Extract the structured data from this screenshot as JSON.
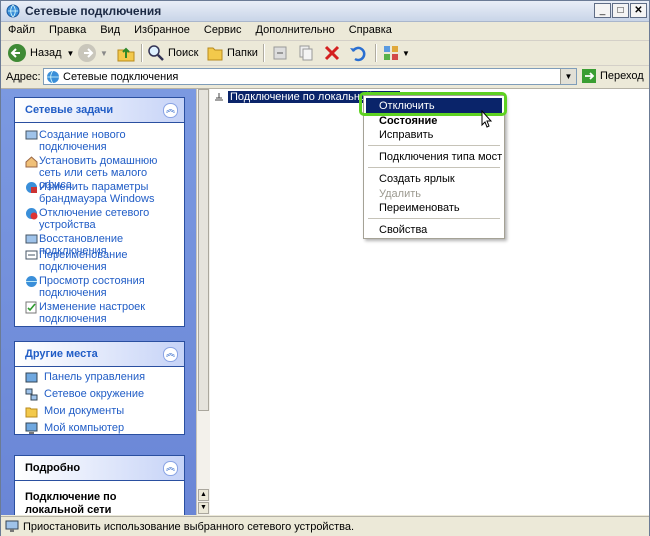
{
  "window": {
    "title": "Сетевые подключения"
  },
  "menu": [
    "Файл",
    "Правка",
    "Вид",
    "Избранное",
    "Сервис",
    "Дополнительно",
    "Справка"
  ],
  "toolbar": {
    "back": "Назад",
    "search": "Поиск",
    "folders": "Папки"
  },
  "address": {
    "label": "Адрес:",
    "value": "Сетевые подключения",
    "go": "Переход"
  },
  "network_tasks": {
    "title": "Сетевые задачи",
    "items": [
      {
        "label": "Создание нового подключения"
      },
      {
        "label": "Установить домашнюю сеть или сеть малого офиса"
      },
      {
        "label": "Изменить параметры брандмауэра Windows"
      },
      {
        "label": "Отключение сетевого устройства"
      },
      {
        "label": "Восстановление подключения"
      },
      {
        "label": "Переименование подключения"
      },
      {
        "label": "Просмотр состояния подключения"
      },
      {
        "label": "Изменение настроек подключения"
      }
    ]
  },
  "other_places": {
    "title": "Другие места",
    "items": [
      {
        "label": "Панель управления"
      },
      {
        "label": "Сетевое окружение"
      },
      {
        "label": "Мои документы"
      },
      {
        "label": "Мой компьютер"
      }
    ]
  },
  "details": {
    "title": "Подробно",
    "name": "Подключение по локальной сети"
  },
  "content": {
    "item_label": "Подключение по локальной сети"
  },
  "context_menu": {
    "items": [
      {
        "label": "Отключить"
      },
      {
        "label": "Состояние"
      },
      {
        "label": "Исправить"
      },
      {
        "label": "Подключения типа мост"
      },
      {
        "label": "Создать ярлык"
      },
      {
        "label": "Удалить"
      },
      {
        "label": "Переименовать"
      },
      {
        "label": "Свойства"
      }
    ]
  },
  "status": {
    "text": "Приостановить использование выбранного сетевого устройства."
  },
  "colors": {
    "highlight": "#0a246a",
    "link": "#215dc6",
    "pane": "#7a96df",
    "callout": "#5ed221"
  }
}
